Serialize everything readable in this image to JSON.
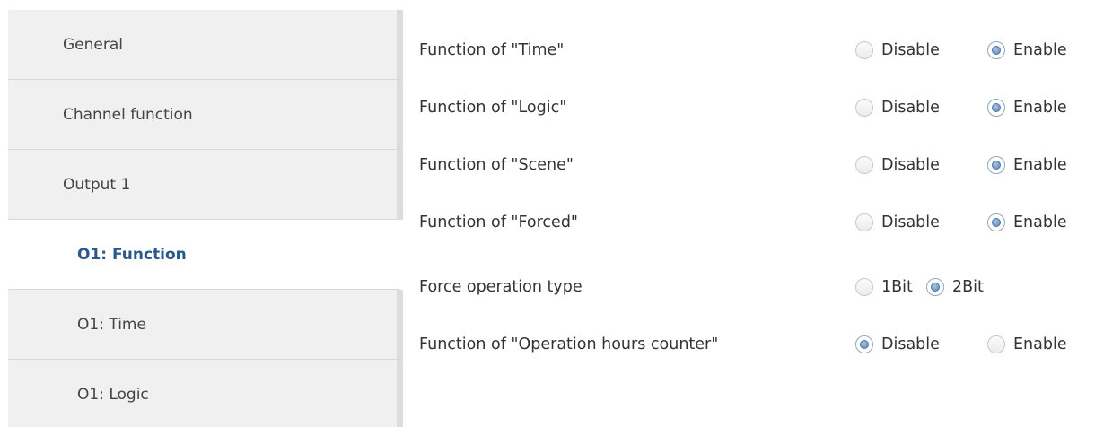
{
  "sidebar": {
    "items": [
      {
        "label": "General"
      },
      {
        "label": "Channel function"
      },
      {
        "label": "Output 1"
      },
      {
        "label": "O1: Function"
      },
      {
        "label": "O1: Time"
      },
      {
        "label": "O1: Logic"
      }
    ],
    "active": "O1: Function"
  },
  "params": {
    "rows": [
      {
        "label": "Function of \"Time\"",
        "options": [
          "Disable",
          "Enable"
        ],
        "selected": "Enable"
      },
      {
        "label": "Function of \"Logic\"",
        "options": [
          "Disable",
          "Enable"
        ],
        "selected": "Enable"
      },
      {
        "label": "Function of \"Scene\"",
        "options": [
          "Disable",
          "Enable"
        ],
        "selected": "Enable"
      },
      {
        "label": "Function of \"Forced\"",
        "options": [
          "Disable",
          "Enable"
        ],
        "selected": "Enable"
      },
      {
        "label": "Force operation type",
        "options": [
          "1Bit",
          "2Bit"
        ],
        "selected": "2Bit"
      },
      {
        "label": "Function of \"Operation hours counter\"",
        "options": [
          "Disable",
          "Enable"
        ],
        "selected": "Disable"
      }
    ]
  },
  "colors": {
    "active_text": "#2a5a8c",
    "sidebar_bg": "#f0f0f0",
    "radio_fill": "#5a83b3"
  }
}
